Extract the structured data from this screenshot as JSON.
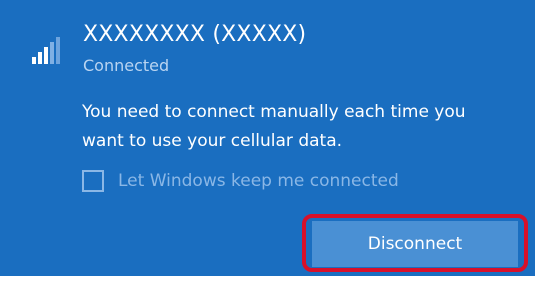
{
  "network": {
    "name": "XXXXXXXX (XXXXX)",
    "status": "Connected",
    "icon": "cellular-signal-icon"
  },
  "message": "You need to connect manually each time you want to use your cellular data.",
  "auto_connect": {
    "label": "Let Windows keep me connected",
    "checked": false,
    "enabled": false
  },
  "actions": {
    "disconnect_label": "Disconnect"
  },
  "colors": {
    "panel_background": "#1a6ec0",
    "button_background": "#4a90d4",
    "highlight_border": "#d8102a",
    "dimmed_text": "#8ab7e6"
  }
}
